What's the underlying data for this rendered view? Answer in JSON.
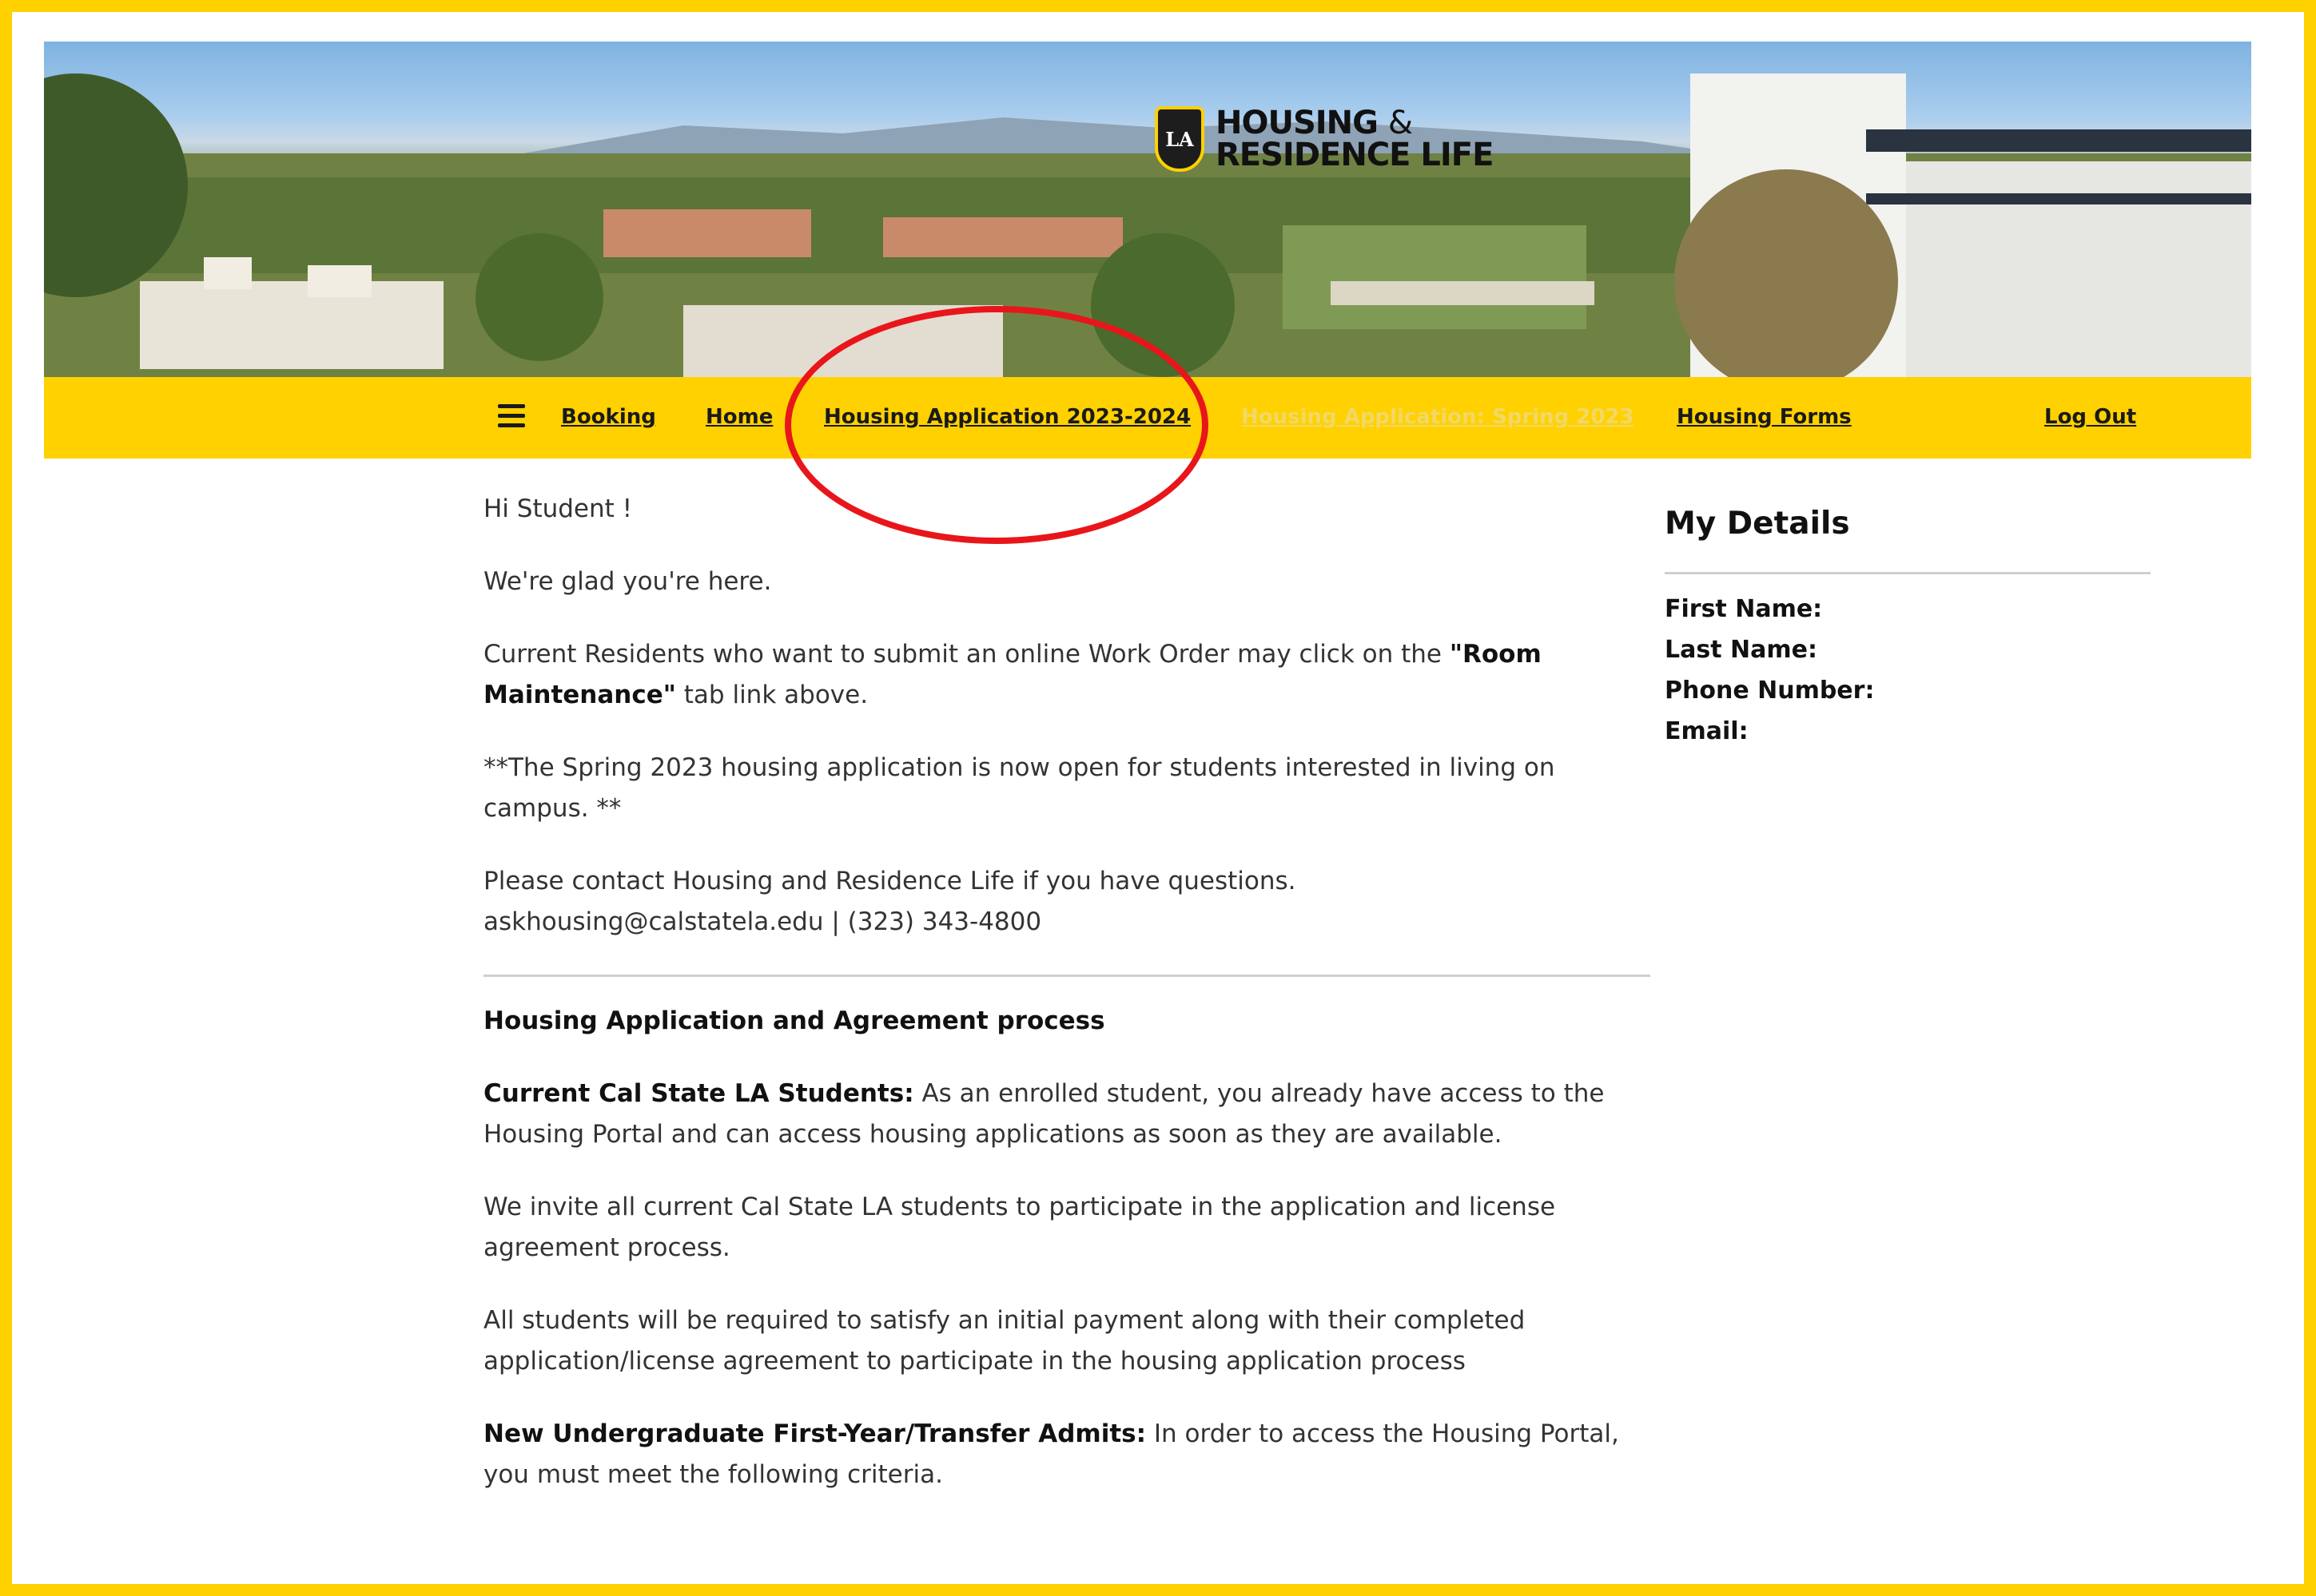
{
  "banner": {
    "logo_badge": "LA",
    "logo_line1": "HOUSING",
    "logo_amp": "&",
    "logo_line2": "RESIDENCE LIFE"
  },
  "nav": {
    "menu_icon": "hamburger-menu-icon",
    "items": [
      {
        "label": "Booking"
      },
      {
        "label": "Home"
      },
      {
        "label": "Housing Application 2023-2024"
      },
      {
        "label": "Housing Application: Spring 2023"
      },
      {
        "label": "Housing Forms"
      },
      {
        "label": "Log Out"
      }
    ]
  },
  "content": {
    "greeting": "Hi   Student !",
    "welcome": "We're glad you're here.",
    "maintenance_pre": "Current Residents who want to submit an online Work Order may click on the ",
    "maintenance_bold": "\"Room Maintenance\"",
    "maintenance_post": " tab link above.",
    "spring_notice": "**The Spring 2023 housing application is now open for students interested in living on campus. **",
    "contact_line1": "Please contact Housing and Residence Life if you have questions.",
    "contact_line2": "askhousing@calstatela.edu | (323) 343-4800",
    "process_heading": "Housing Application and Agreement process",
    "current_bold": "Current Cal State LA Students:",
    "current_text": " As an enrolled student, you already have access to the Housing Portal and can access housing applications as soon as they are available.",
    "invite": "We invite all current Cal State LA students to participate in the application and license agreement process.",
    "payment": "All students will be required to satisfy an initial payment along with their completed application/license agreement to participate in the housing application process",
    "new_bold": "New Undergraduate First-Year/Transfer Admits:",
    "new_text": " In order to access the Housing Portal, you must meet the following criteria."
  },
  "details": {
    "title": "My Details",
    "first_name": "First Name:",
    "last_name": "Last Name:",
    "phone": "Phone Number:",
    "email": "Email:"
  },
  "colors": {
    "brand_yellow": "#FFD100",
    "annotation_red": "#E8161B"
  }
}
